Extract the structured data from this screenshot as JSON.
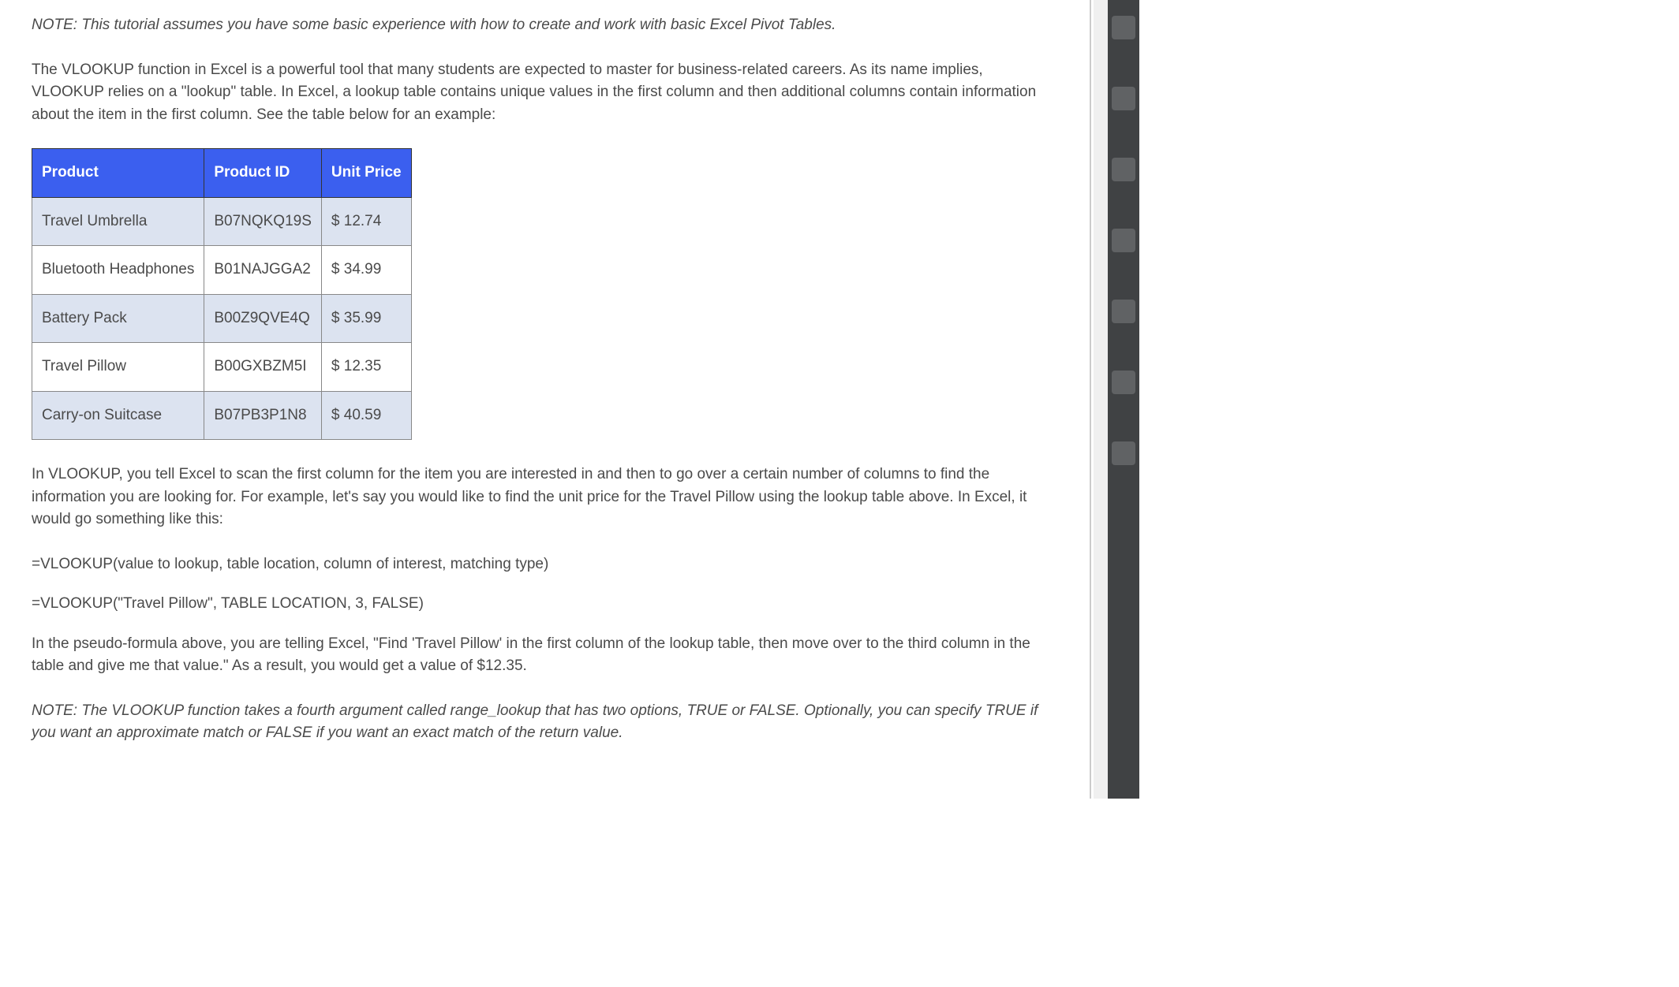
{
  "note1": "NOTE: This tutorial assumes you have some basic experience with how to create and work with basic Excel Pivot Tables.",
  "para1": "The VLOOKUP function in Excel is a powerful tool that many students are expected to master for business-related careers. As its name implies, VLOOKUP relies on a \"lookup\" table. In Excel, a lookup table contains unique values in the first column and then additional columns contain information about the item in the first column. See the table below for an example:",
  "table": {
    "headers": [
      "Product",
      "Product ID",
      "Unit Price"
    ],
    "rows": [
      [
        "Travel Umbrella",
        "B07NQKQ19S",
        "$ 12.74"
      ],
      [
        "Bluetooth Headphones",
        "B01NAJGGA2",
        "$ 34.99"
      ],
      [
        "Battery Pack",
        "B00Z9QVE4Q",
        "$ 35.99"
      ],
      [
        "Travel Pillow",
        "B00GXBZM5I",
        "$ 12.35"
      ],
      [
        "Carry-on Suitcase",
        "B07PB3P1N8",
        "$ 40.59"
      ]
    ]
  },
  "para2": "In VLOOKUP, you tell Excel to scan the first column for the item you are interested in and then to go over a certain number of columns to find the information you are looking for. For example, let's say you would like to find the unit price for the Travel Pillow using the lookup table above. In Excel, it would go something like this:",
  "formula1": "=VLOOKUP(value to lookup, table location, column of interest, matching type)",
  "formula2": "=VLOOKUP(\"Travel Pillow\", TABLE LOCATION, 3, FALSE)",
  "para3": "In the pseudo-formula above, you are telling Excel, \"Find 'Travel Pillow' in the first column of the lookup table, then move over to the third column in the table and give me that value.\" As a result, you would get a value of $12.35.",
  "note2": "NOTE: The VLOOKUP function takes a fourth argument called range_lookup that has two options, TRUE or FALSE. Optionally, you can specify TRUE if you want an approximate match or FALSE if you want an exact match of the return value."
}
